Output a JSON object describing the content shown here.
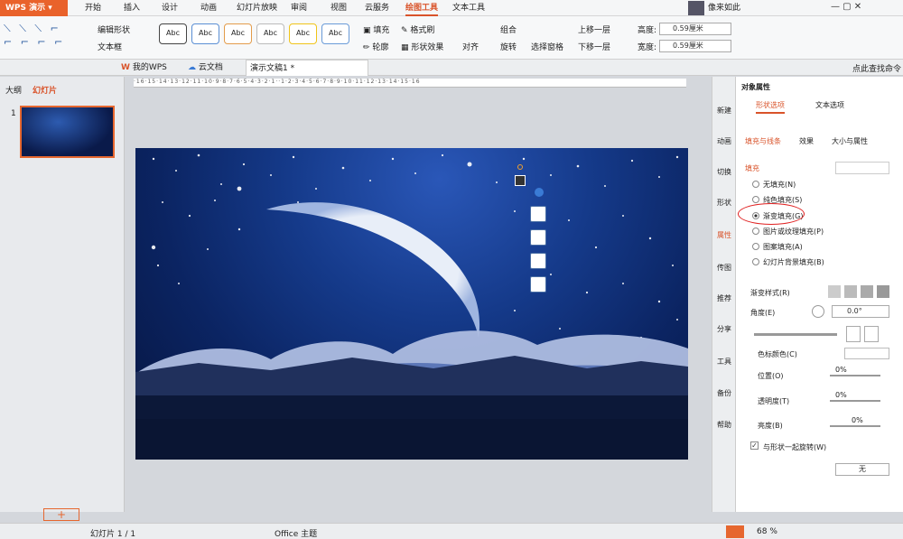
{
  "app": {
    "name": "WPS 演示"
  },
  "menu": {
    "items": [
      "开始",
      "插入",
      "设计",
      "动画",
      "幻灯片放映",
      "审阅",
      "视图",
      "云服务",
      "绘图工具",
      "文本工具"
    ],
    "active": "绘图工具"
  },
  "account": {
    "name": "像来如此"
  },
  "ribbon": {
    "edit_shape": "编辑形状",
    "text_box": "文本框",
    "style_label": "Abc",
    "fill": "填充",
    "format_painter": "格式刷",
    "outline": "轮廓",
    "shape_effects": "形状效果",
    "align": "对齐",
    "group": "组合",
    "rotate": "旋转",
    "selection_pane": "选择窗格",
    "bring_forward": "上移一层",
    "send_backward": "下移一层",
    "height_label": "高度:",
    "height_value": "0.59厘米",
    "width_label": "宽度:",
    "width_value": "0.59厘米"
  },
  "tabs": {
    "my_wps": "我的WPS",
    "cloud_docs": "云文档",
    "document": "演示文稿1 *",
    "search_cmd": "点此查找命令"
  },
  "left_panel": {
    "outline": "大纲",
    "slides": "幻灯片",
    "slide_number": "1"
  },
  "sidebar": [
    "新建",
    "动画",
    "切换",
    "形状",
    "属性",
    "传图",
    "推荐",
    "分享",
    "工具",
    "备份",
    "帮助"
  ],
  "properties": {
    "title": "对象属性",
    "tab_shape": "形状选项",
    "tab_text": "文本选项",
    "sub_fill_line": "填充与线条",
    "sub_effects": "效果",
    "sub_size": "大小与属性",
    "fill_header": "填充",
    "options": [
      "无填充(N)",
      "纯色填充(S)",
      "渐变填充(G)",
      "图片或纹理填充(P)",
      "图案填充(A)",
      "幻灯片背景填充(B)"
    ],
    "selected": "渐变填充(G)",
    "gradient_style": "渐变样式(R)",
    "angle": "角度(E)",
    "angle_value": "0.0°",
    "stop_color": "色标颜色(C)",
    "position": "位置(O)",
    "position_value": "0%",
    "transparency": "透明度(T)",
    "transparency_value": "0%",
    "brightness": "亮度(B)",
    "brightness_value": "0%",
    "rotate_with_shape": "与形状一起旋转(W)",
    "none_value": "无"
  },
  "status": {
    "slide_info": "幻灯片 1 / 1",
    "theme": "Office 主题",
    "zoom": "68 %"
  },
  "colors": {
    "accent": "#e6672f",
    "brand": "#e9622b"
  }
}
